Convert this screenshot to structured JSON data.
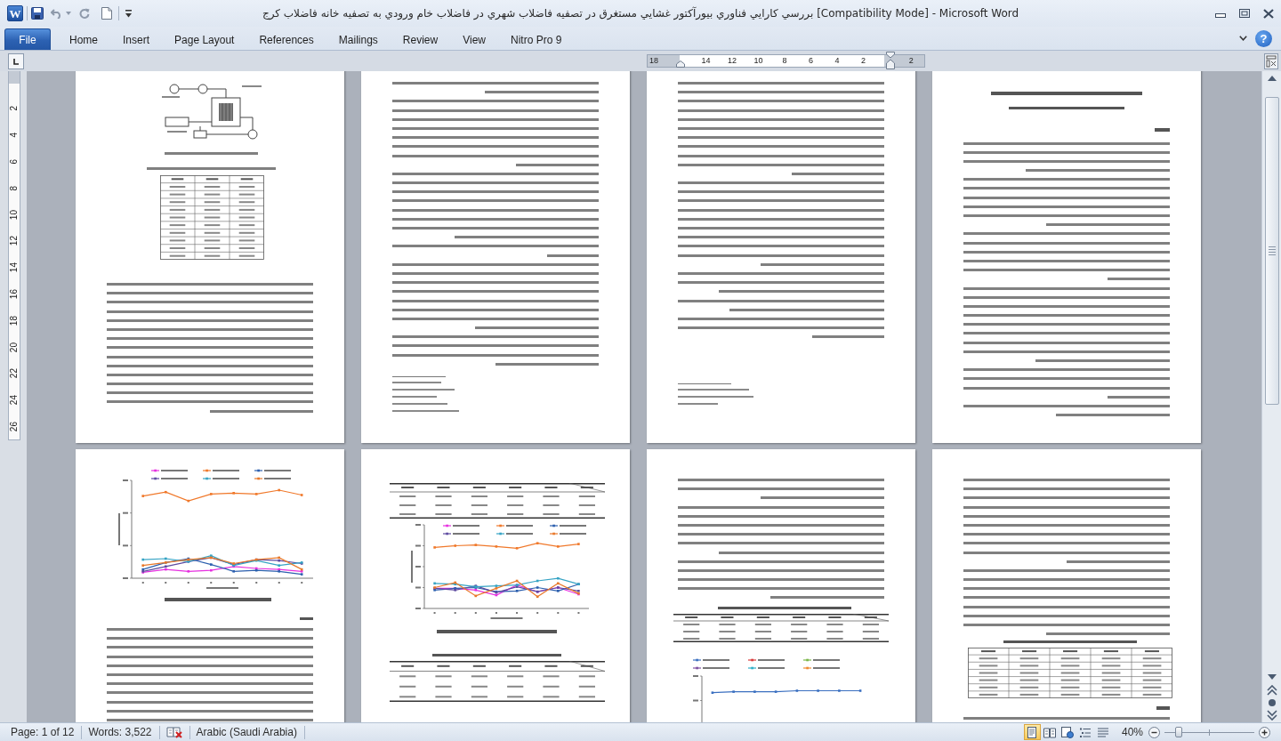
{
  "window": {
    "app_icon": "W",
    "title": "بررسي كارايي فناوري بيورآكتور غشايي مستغرق در تصفيه فاضلاب شهري در فاضلاب خام ورودي به تصفيه خانه فاضلاب كرج [Compatibility Mode] - Microsoft Word"
  },
  "ribbon": {
    "tabs": [
      {
        "label": "File",
        "kind": "file",
        "selected": false
      },
      {
        "label": "Home",
        "kind": "tab",
        "selected": false
      },
      {
        "label": "Insert",
        "kind": "tab",
        "selected": false
      },
      {
        "label": "Page Layout",
        "kind": "tab",
        "selected": false
      },
      {
        "label": "References",
        "kind": "tab",
        "selected": false
      },
      {
        "label": "Mailings",
        "kind": "tab",
        "selected": false
      },
      {
        "label": "Review",
        "kind": "tab",
        "selected": false
      },
      {
        "label": "View",
        "kind": "tab",
        "selected": false
      },
      {
        "label": "Nitro Pro 9",
        "kind": "tab",
        "selected": false
      }
    ],
    "help": "?"
  },
  "rulers": {
    "horizontal": [
      "18",
      "14",
      "12",
      "10",
      "8",
      "6",
      "4",
      "2",
      "2"
    ],
    "vertical": [
      "2",
      "4",
      "6",
      "8",
      "10",
      "12",
      "14",
      "16",
      "18",
      "20",
      "22",
      "24",
      "26"
    ]
  },
  "document": {
    "pages": [
      {
        "kind": "figure-table-text"
      },
      {
        "kind": "text-long-footnotes"
      },
      {
        "kind": "text-short-footnotes"
      },
      {
        "kind": "title-abstract"
      },
      {
        "kind": "chart-text"
      },
      {
        "kind": "table-chart-table"
      },
      {
        "kind": "text-table-chart"
      },
      {
        "kind": "text-table-text"
      }
    ]
  },
  "status_bar": {
    "page": "Page: 1 of 12",
    "words": "Words: 3,522",
    "language": "Arabic (Saudi Arabia)",
    "views": [
      {
        "kind": "print-layout",
        "selected": true
      },
      {
        "kind": "full-screen-reading",
        "selected": false
      },
      {
        "kind": "web-layout",
        "selected": false
      },
      {
        "kind": "outline",
        "selected": false
      },
      {
        "kind": "draft",
        "selected": false
      }
    ],
    "zoom": "40%",
    "zoom_slider": {
      "level": 0.16
    }
  }
}
